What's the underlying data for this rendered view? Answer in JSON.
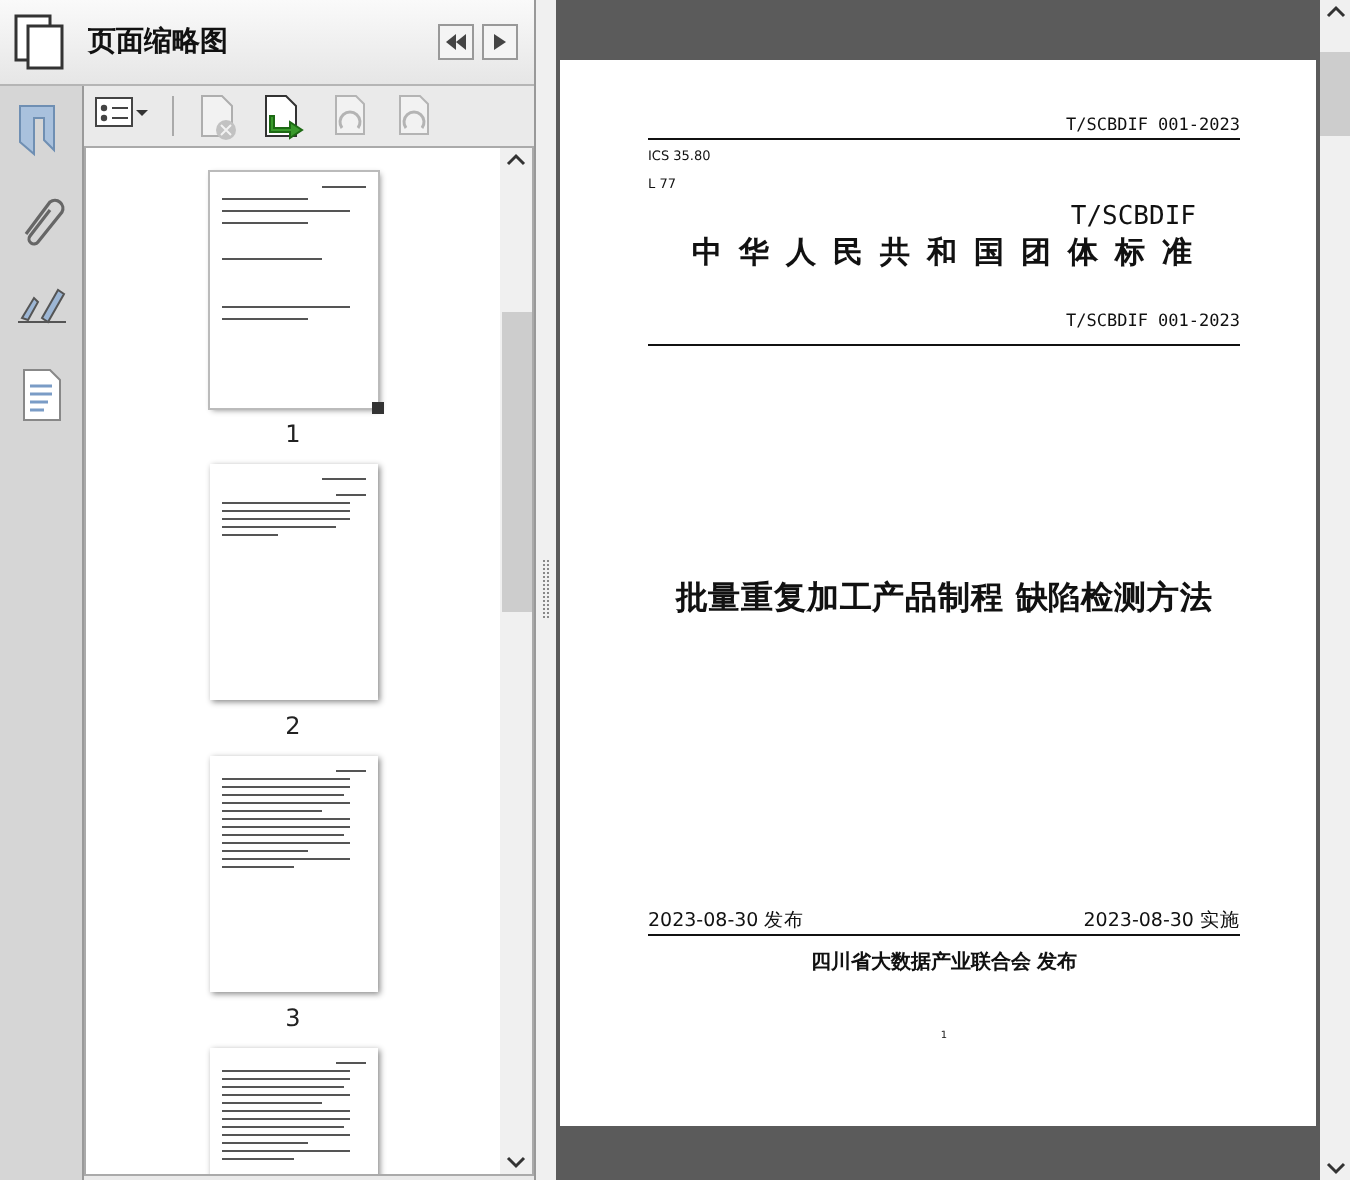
{
  "panel": {
    "title": "页面缩略图"
  },
  "toolbar": [
    {
      "kind": "options",
      "disabled": false
    },
    {
      "kind": "delete",
      "disabled": true
    },
    {
      "kind": "insert",
      "disabled": false
    },
    {
      "kind": "rotate-left",
      "disabled": true
    },
    {
      "kind": "rotate-right",
      "disabled": true
    }
  ],
  "rail": [
    {
      "kind": "bookmark"
    },
    {
      "kind": "attachment"
    },
    {
      "kind": "signature"
    },
    {
      "kind": "pages"
    }
  ],
  "thumbnails": [
    {
      "label": "1",
      "kind": "cover",
      "selected": true
    },
    {
      "label": "2",
      "kind": "toc",
      "selected": false
    },
    {
      "label": "3",
      "kind": "text",
      "selected": false
    },
    {
      "kind": "text",
      "selected": false
    }
  ],
  "document": {
    "header_code": "T/SCBDIF 001-2023",
    "ics": "ICS 35.80",
    "class_code": "L 77",
    "org_code": "T/SCBDIF",
    "standard_type": "中华人民共和国团体标准",
    "code": "T/SCBDIF 001-2023",
    "title": "批量重复加工产品制程 缺陷检测方法",
    "issue_date": "2023-08-30 发布",
    "effective_date": "2023-08-30 实施",
    "publisher": "四川省大数据产业联合会 发布",
    "page_number": "1"
  }
}
